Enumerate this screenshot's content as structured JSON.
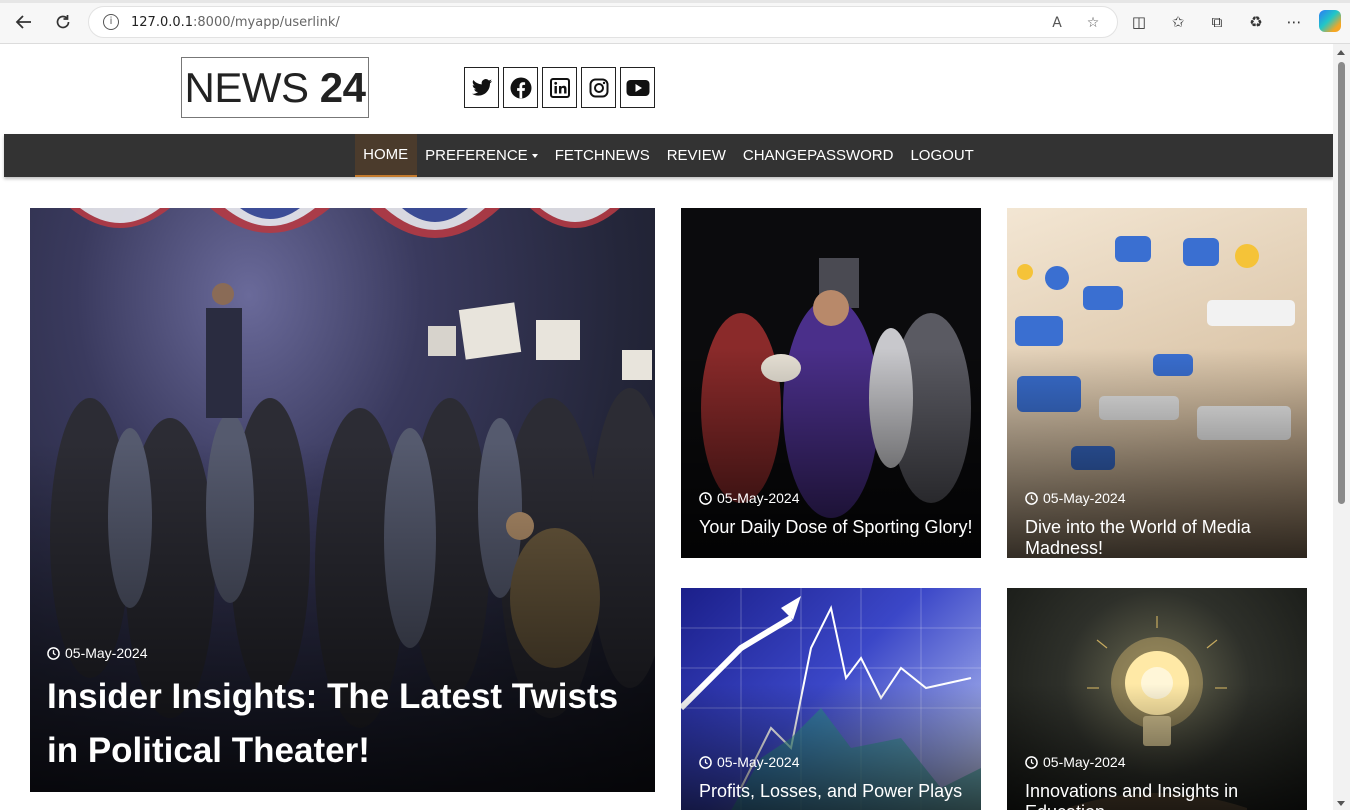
{
  "browser": {
    "url_host": "127.0.0.1",
    "url_rest": ":8000/myapp/userlink/"
  },
  "site": {
    "logo_word": "NEWS",
    "logo_number": "24",
    "socials": [
      "twitter-icon",
      "facebook-icon",
      "linkedin-icon",
      "instagram-icon",
      "youtube-icon"
    ]
  },
  "nav": {
    "home": "HOME",
    "preference": "PREFERENCE",
    "fetchnews": "FETCHNEWS",
    "review": "REVIEW",
    "changepassword": "CHANGEPASSWORD",
    "logout": "LOGOUT"
  },
  "articles": {
    "featured": {
      "date": "05-May-2024",
      "title": "Insider Insights: The Latest Twists in Political Theater!"
    },
    "sports": {
      "date": "05-May-2024",
      "title": "Your Daily Dose of Sporting Glory!"
    },
    "media": {
      "date": "05-May-2024",
      "title": "Dive into the World of Media Madness!"
    },
    "business": {
      "date": "05-May-2024",
      "title": "Profits, Losses, and Power Plays"
    },
    "education": {
      "date": "05-May-2024",
      "title": "Innovations and Insights in Education"
    }
  },
  "colors": {
    "navbar": "#333333",
    "nav_active": "#4b3b2c",
    "nav_active_border": "#c47a2c"
  }
}
